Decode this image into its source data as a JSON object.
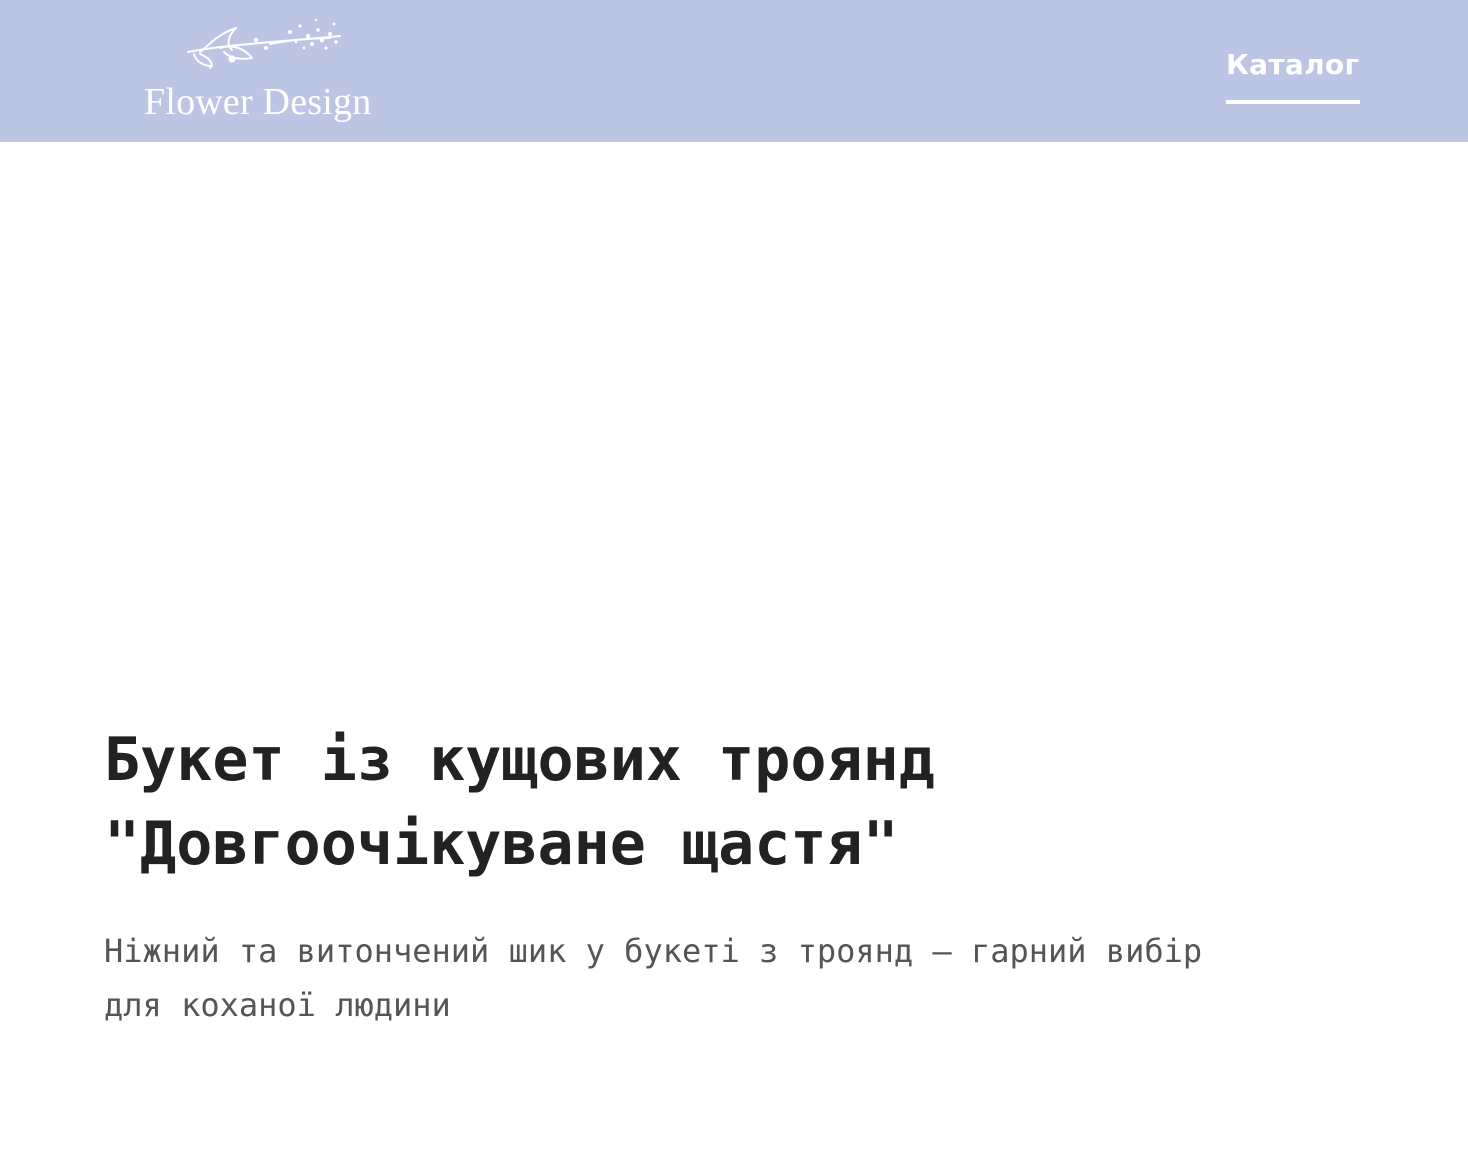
{
  "header": {
    "logo_text": "Flower Design",
    "nav": {
      "catalog_label": "Каталог"
    }
  },
  "hero": {
    "title": "Букет із кущових троянд \"Довгоочікуване щастя\"",
    "subtitle": "Ніжний та витончений шик у букеті з троянд — гарний вибір для коханої людини"
  },
  "colors": {
    "header_bg": "#bcc5e3",
    "title": "#222222",
    "subtitle": "#555555"
  },
  "icons": {
    "logo": "flower-branch-icon"
  }
}
